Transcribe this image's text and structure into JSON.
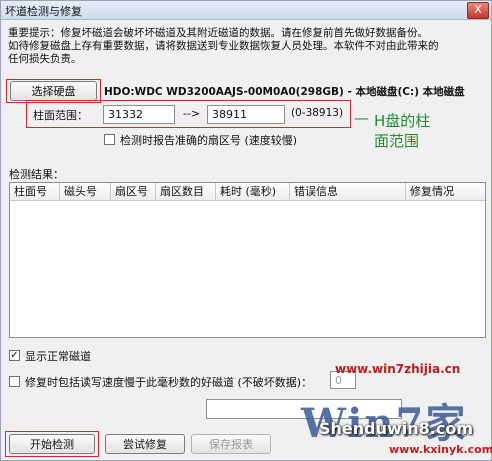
{
  "window": {
    "title": "坏道检测与修复",
    "close_glyph": "X"
  },
  "notice": {
    "line1": "重要提示：修复坏磁道会破坏坏磁道及其附近磁道的数据。请在修复前首先做好数据备份。",
    "line2": "如待修复磁盘上存有重要数据，请将数据送到专业数据恢复人员处理。本软件不对由此带来的",
    "line3": "任何损失负责。"
  },
  "disk": {
    "select_button": "选择硬盘",
    "description": "HDO:WDC WD3200AAJS-00M0A0(298GB) - 本地磁盘(C:) 本地磁盘"
  },
  "cylinder": {
    "label": "柱面范围：",
    "start": "31332",
    "arrow": "-->",
    "end": "38911",
    "range_hint": "(0-38913)"
  },
  "annotation": {
    "line1": "H盘的柱",
    "line2": "面范围"
  },
  "options": {
    "report_sector": "检测时报告准确的扇区号 (速度较慢)",
    "show_normal": "显示正常磁道",
    "repair_slow": "修复时包括读写速度慢于此毫秒数的好磁道 (不破坏数据)：",
    "repair_slow_value": "0"
  },
  "results": {
    "label": "检测结果：",
    "columns": [
      "柱面号",
      "磁头号",
      "扇区号",
      "扇区数目",
      "耗时 (毫秒)",
      "错误信息",
      "修复情况"
    ]
  },
  "buttons": {
    "start": "开始检测",
    "try_repair": "尝试修复",
    "save_report": "保存报表"
  },
  "watermarks": {
    "url": "www.win7zhijia.cn",
    "logo": "Win7家",
    "brand": "Shenduwin8.com",
    "site": "www.kxinyk.com"
  },
  "colors": {
    "highlight": "#d9272e",
    "annotation": "#1c8f2a"
  }
}
